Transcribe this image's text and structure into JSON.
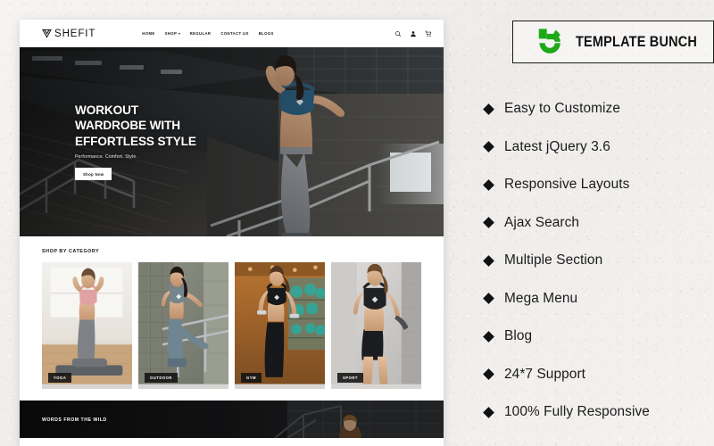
{
  "site": {
    "header": {
      "logo_text": "SHEFIT",
      "logo_icon": "shefit-triangle-logo",
      "nav": [
        {
          "label": "HOME",
          "has_dropdown": false
        },
        {
          "label": "SHOP",
          "has_dropdown": true
        },
        {
          "label": "REGULAR",
          "has_dropdown": false
        },
        {
          "label": "CONTACT US",
          "has_dropdown": false
        },
        {
          "label": "BLOGS",
          "has_dropdown": false
        }
      ],
      "icons": [
        {
          "name": "search-icon"
        },
        {
          "name": "user-account-icon"
        },
        {
          "name": "shopping-cart-icon"
        }
      ]
    },
    "hero": {
      "title_line1": "WORKOUT",
      "title_line2": "WARDROBE WITH",
      "title_line3": "EFFORTLESS STYLE",
      "subtitle": "Performance. Comfort. Style.",
      "button_label": "Shop Now"
    },
    "category_section": {
      "heading": "SHOP BY CATEGORY",
      "categories": [
        {
          "label": "YOGA"
        },
        {
          "label": "OUTDOOR"
        },
        {
          "label": "GYM"
        },
        {
          "label": "SPORT"
        }
      ]
    },
    "testimonial_section": {
      "heading": "WORDS FROM THE WILD"
    }
  },
  "promo": {
    "brand_name": "TEMPLATE BUNCH",
    "brand_mark": "tb-green-logo",
    "brand_color": "#1DA818",
    "features": [
      {
        "label": "Easy to Customize"
      },
      {
        "label": "Latest jQuery 3.6"
      },
      {
        "label": "Responsive Layouts"
      },
      {
        "label": "Ajax Search"
      },
      {
        "label": "Multiple Section"
      },
      {
        "label": "Mega Menu"
      },
      {
        "label": "Blog"
      },
      {
        "label": "24*7 Support"
      },
      {
        "label": "100% Fully Responsive"
      }
    ]
  }
}
